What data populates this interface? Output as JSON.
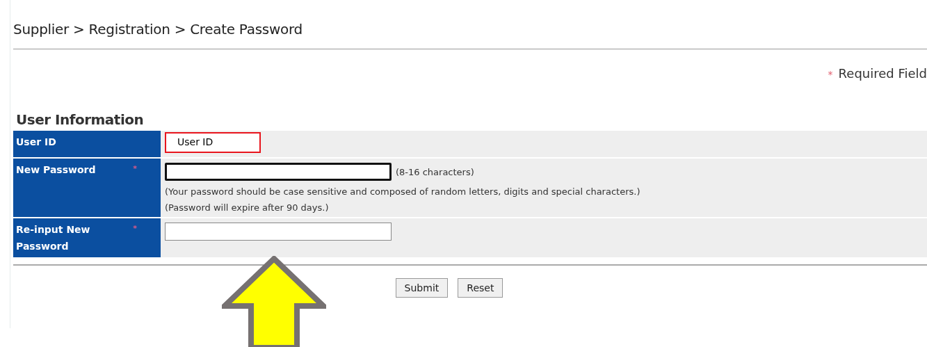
{
  "breadcrumb": "Supplier > Registration > Create Password",
  "required_note": {
    "marker": "*",
    "text": "Required Field"
  },
  "section_title": "User Information",
  "fields": [
    {
      "kind": "display",
      "label": "User ID",
      "required": false,
      "value": "User ID",
      "highlighted": true
    },
    {
      "kind": "password",
      "label": "New Password",
      "required": true,
      "focused": true,
      "suffix": "(8-16 characters)",
      "hints": [
        "(Your password should be case sensitive and composed of random letters, digits and special characters.)",
        "(Password will expire after 90 days.)"
      ]
    },
    {
      "kind": "password",
      "label": "Re-input New Password",
      "required": true,
      "focused": false
    }
  ],
  "buttons": [
    "Submit",
    "Reset"
  ]
}
